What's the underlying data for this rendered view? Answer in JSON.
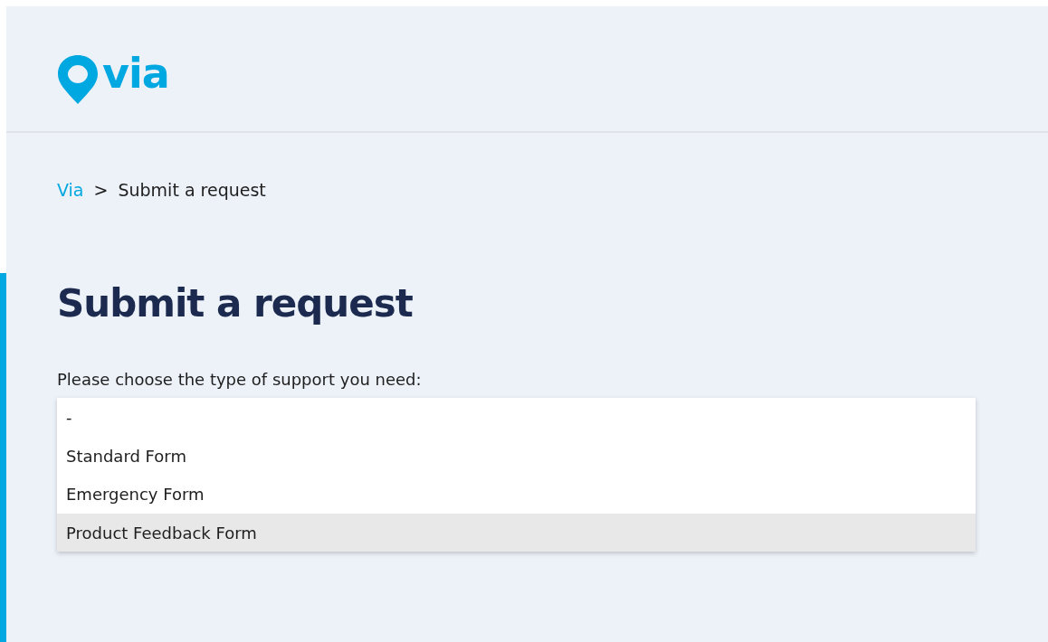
{
  "header": {
    "logo_text": "via"
  },
  "breadcrumb": [
    {
      "label": "Via",
      "kind": "link"
    },
    {
      "label": ">",
      "kind": "separator"
    },
    {
      "label": "Submit a request",
      "kind": "current"
    }
  ],
  "heading": "Submit a request",
  "form": {
    "label": "Please choose the type of support you need:",
    "options": [
      {
        "label": "-",
        "selected": false
      },
      {
        "label": "Standard Form",
        "selected": false
      },
      {
        "label": "Emergency Form",
        "selected": false
      },
      {
        "label": "Product Feedback Form",
        "selected": true
      }
    ]
  }
}
